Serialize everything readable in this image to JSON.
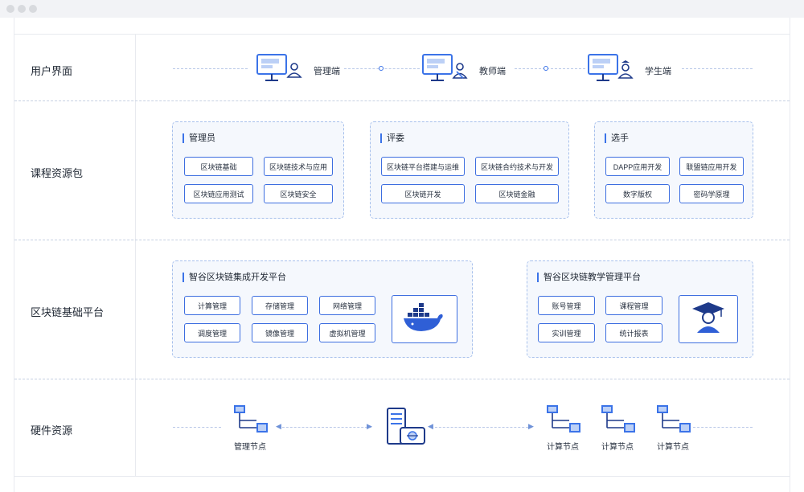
{
  "rows": {
    "user": "用户界面",
    "course": "课程资源包",
    "platform": "区块链基础平台",
    "hardware": "硬件资源"
  },
  "clients": [
    {
      "label": "管理端",
      "icon": "monitor-user-icon"
    },
    {
      "label": "教师端",
      "icon": "monitor-teacher-icon"
    },
    {
      "label": "学生端",
      "icon": "monitor-student-icon"
    }
  ],
  "course_panels": [
    {
      "title": "管理员",
      "items": [
        "区块链基础",
        "区块链技术与应用",
        "区块链应用测试",
        "区块链安全"
      ]
    },
    {
      "title": "评委",
      "items": [
        "区块链平台搭建与运维",
        "区块链合约技术与开发",
        "区块链开发",
        "区块链金融"
      ]
    },
    {
      "title": "选手",
      "items": [
        "DAPP应用开发",
        "联盟链应用开发",
        "数字版权",
        "密码学原理"
      ]
    }
  ],
  "platform_panels": [
    {
      "title": "智谷区块链集成开发平台",
      "items": [
        "计算管理",
        "存储管理",
        "网络管理",
        "调度管理",
        "镜像管理",
        "虚拟机管理"
      ],
      "logo": "docker-whale-icon"
    },
    {
      "title": "智谷区块链教学管理平台",
      "items": [
        "账号管理",
        "课程管理",
        "实训管理",
        "统计报表"
      ],
      "logo": "graduate-icon"
    }
  ],
  "hardware": {
    "management_node": "管理节点",
    "compute_nodes": [
      "计算节点",
      "计算节点",
      "计算节点"
    ],
    "server_icon": "server-icon"
  },
  "colors": {
    "accent": "#3b73e8",
    "panel_bg": "#f5f8fd",
    "panel_border": "#a7c0ec",
    "dark": "#1e3a8a"
  }
}
